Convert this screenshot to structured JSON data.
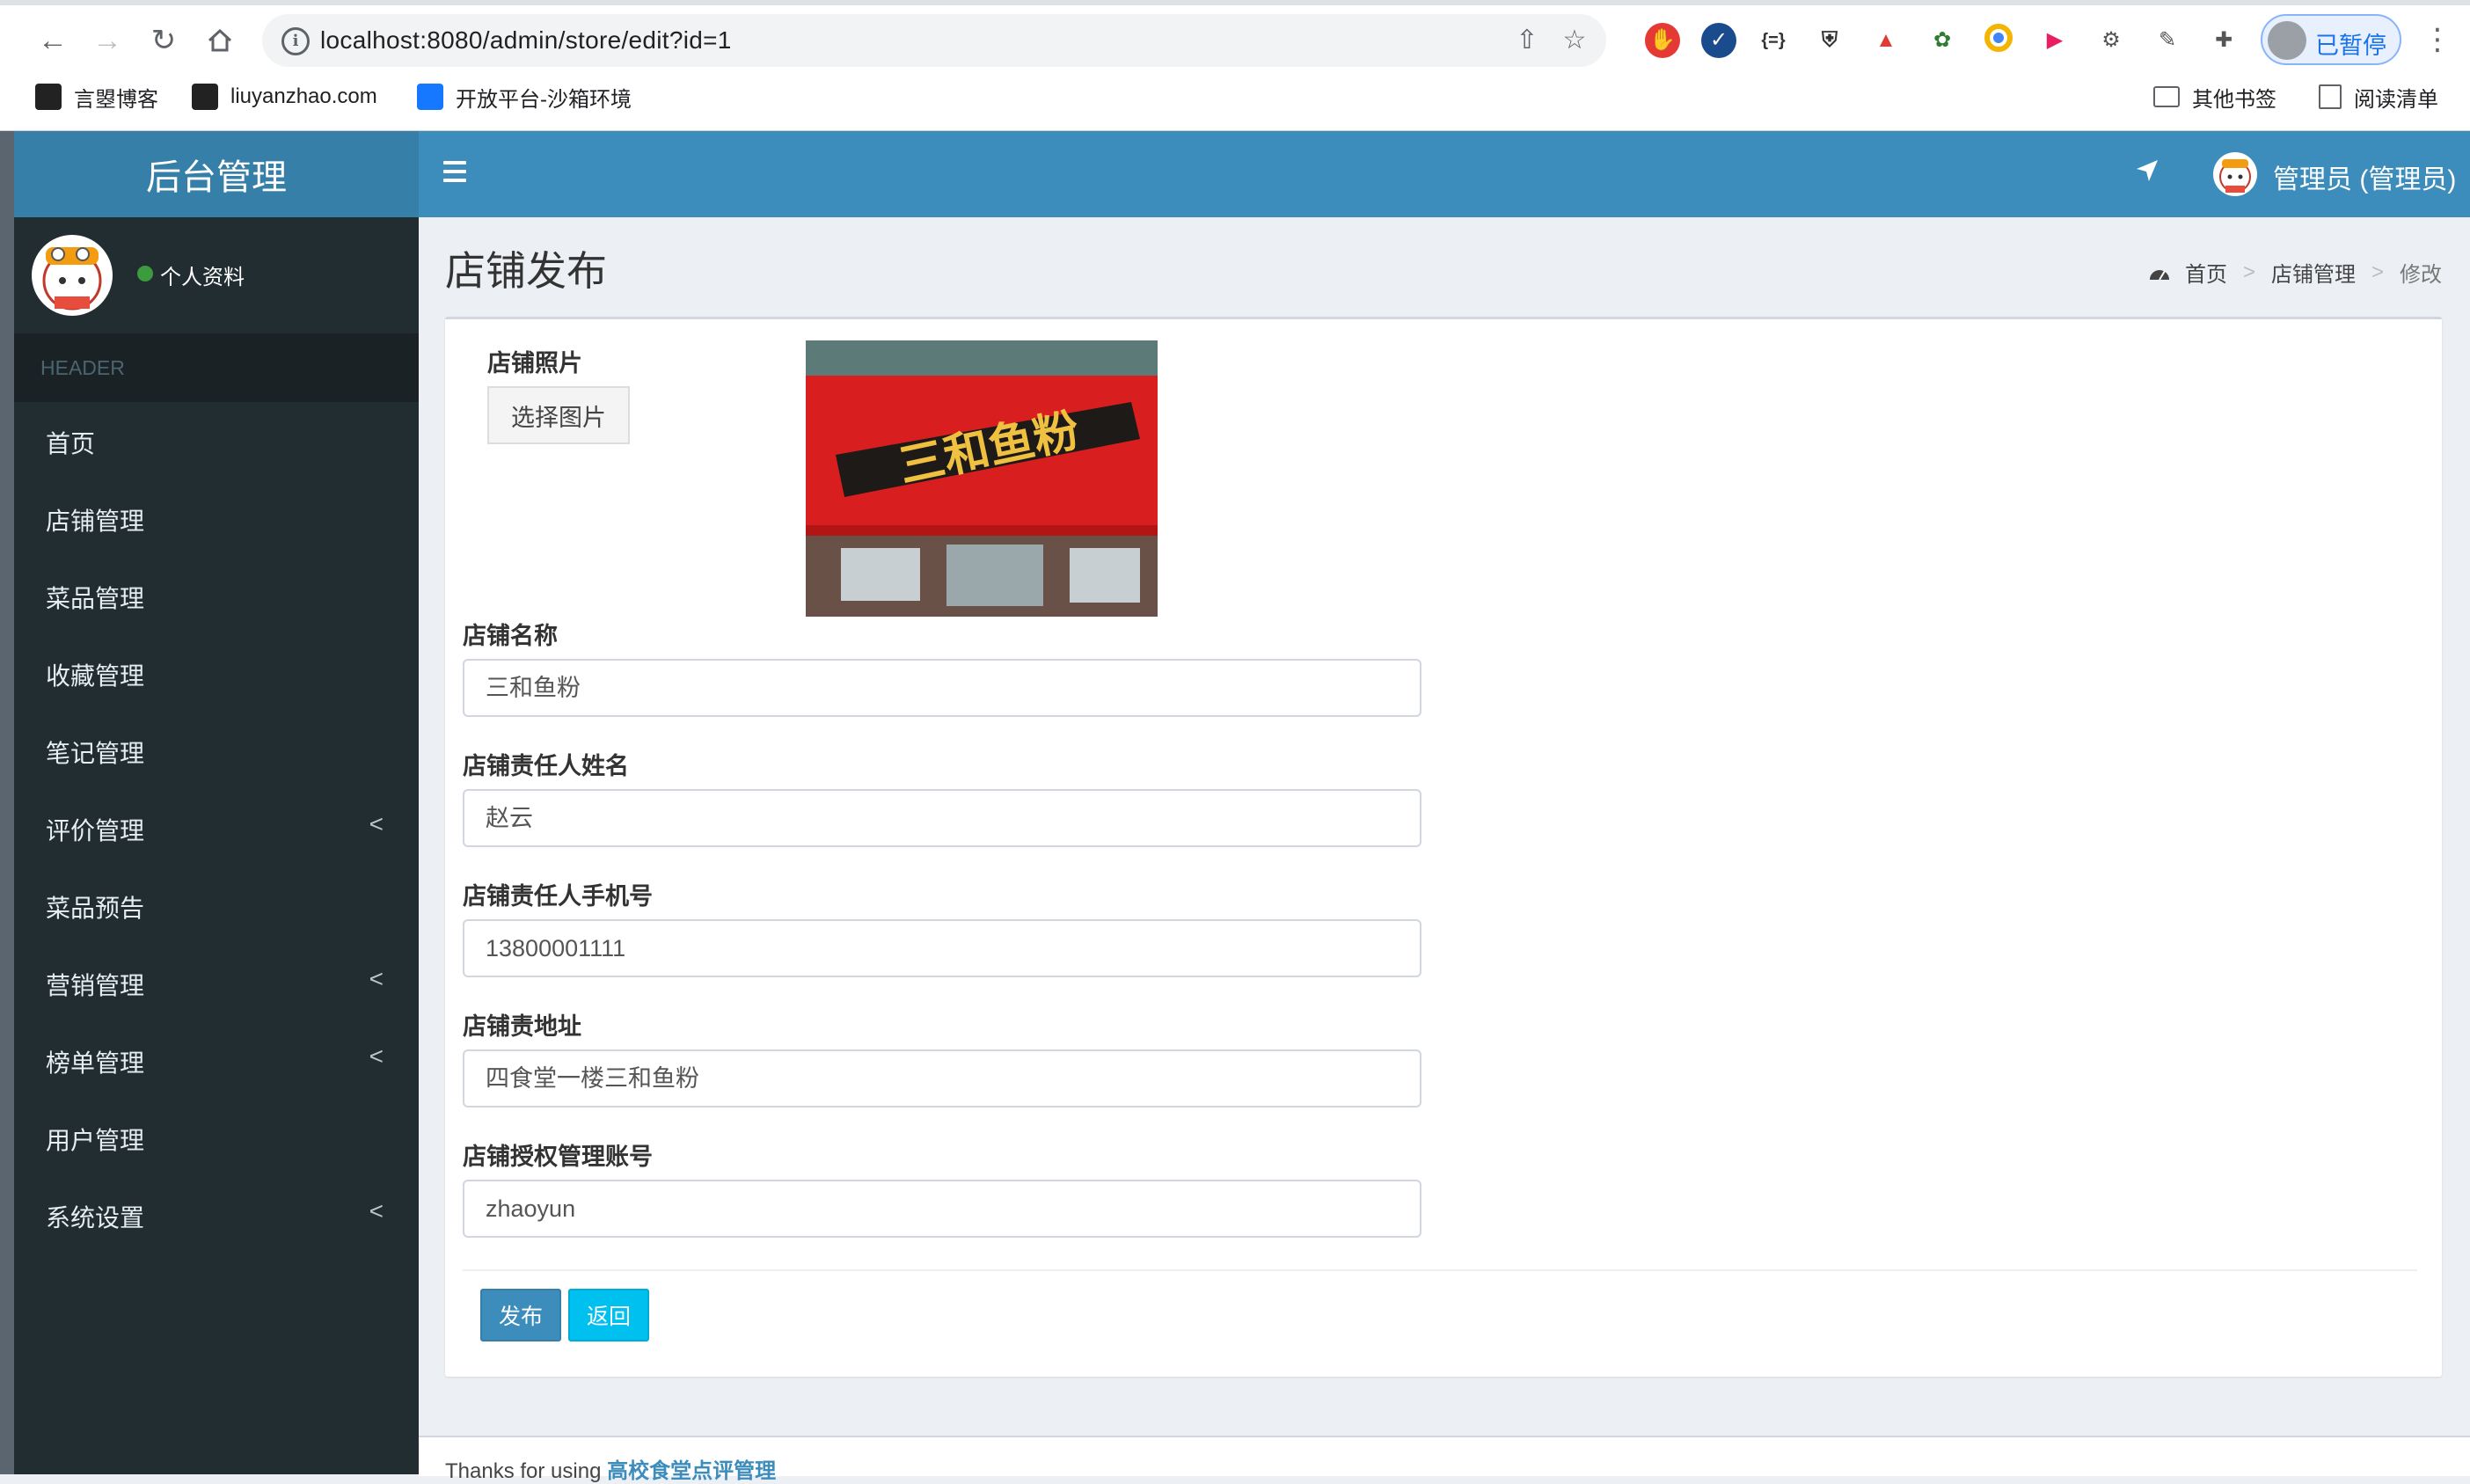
{
  "browser": {
    "url": "localhost:8080/admin/store/edit?id=1",
    "paused_label": "已暂停",
    "bookmarks": [
      "言曌博客",
      "liuyanzhao.com",
      "开放平台-沙箱环境"
    ],
    "other_bookmarks": "其他书签",
    "reading_list": "阅读清单"
  },
  "app": {
    "brand": "后台管理",
    "user_name": "管理员 (管理员)"
  },
  "sidebar": {
    "profile_label": "个人资料",
    "header": "HEADER",
    "items": [
      {
        "label": "首页"
      },
      {
        "label": "店铺管理"
      },
      {
        "label": "菜品管理"
      },
      {
        "label": "收藏管理"
      },
      {
        "label": "笔记管理"
      },
      {
        "label": "评价管理",
        "chevron": "<"
      },
      {
        "label": "菜品预告"
      },
      {
        "label": "营销管理",
        "chevron": "<"
      },
      {
        "label": "榜单管理",
        "chevron": "<"
      },
      {
        "label": "用户管理"
      },
      {
        "label": "系统设置",
        "chevron": "<"
      }
    ]
  },
  "page": {
    "title": "店铺发布",
    "breadcrumb": {
      "home": "首页",
      "section": "店铺管理",
      "current": "修改",
      "sep": ">"
    }
  },
  "form": {
    "photo_label": "店铺照片",
    "choose_image": "选择图片",
    "sign_text": "三和鱼粉",
    "name_label": "店铺名称",
    "name_value": "三和鱼粉",
    "owner_label": "店铺责任人姓名",
    "owner_value": "赵云",
    "phone_label": "店铺责任人手机号",
    "phone_value": "13800001111",
    "address_label": "店铺责地址",
    "address_value": "四食堂一楼三和鱼粉",
    "account_label": "店铺授权管理账号",
    "account_value": "zhaoyun",
    "publish": "发布",
    "back": "返回"
  },
  "footer": {
    "text": "Thanks for using",
    "link": "高校食堂点评管理"
  },
  "icons": {
    "back": "arrow-left-icon",
    "forward": "arrow-right-icon",
    "reload": "reload-icon",
    "home": "home-icon",
    "share": "share-icon",
    "star": "star-icon",
    "location": "location-arrow-icon",
    "dashboard": "dashboard-icon"
  },
  "colors": {
    "header": "#3c8dbc",
    "sidebar": "#222d32",
    "publish": "#3c8dbc",
    "back": "#00c0ef"
  }
}
